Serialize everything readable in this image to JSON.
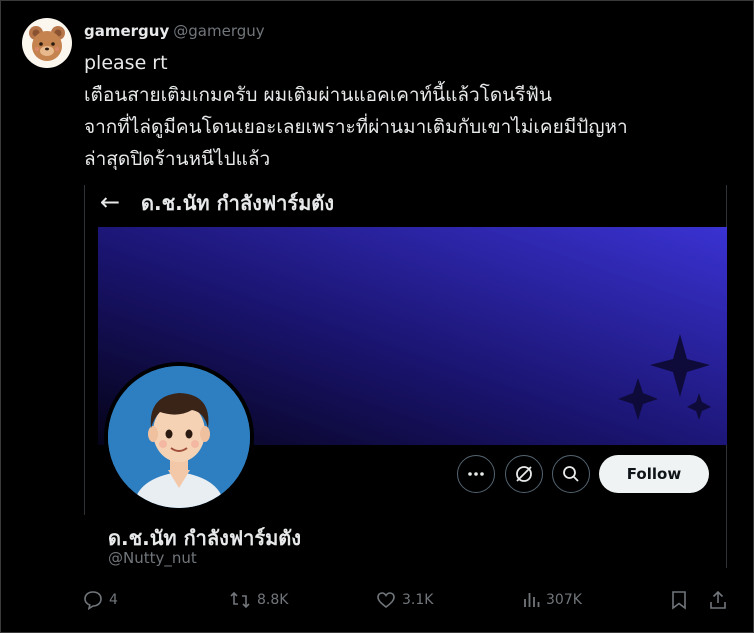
{
  "tweet": {
    "author_name": "gamerguy",
    "author_handle": "@gamerguy",
    "lines": [
      "please rt",
      "เตือนสายเติมเกมครับ ผมเติมผ่านแอคเคาท์นี้แล้วโดนรีฟัน",
      "จากที่ไล่ดูมีคนโดนเยอะเลยเพราะที่ผ่านมาเติมกับเขาไม่เคยมีปัญหา",
      "ล่าสุดปิดร้านหนีไปแล้ว"
    ]
  },
  "embed": {
    "title": "ด.ช.นัท กำลังฟาร์มตัง",
    "follow_label": "Follow",
    "profile_name": "ด.ช.นัท กำลังฟาร์มตัง",
    "profile_handle": "@Nutty_nut",
    "banner_colors": [
      "#050318",
      "#3a32d2"
    ]
  },
  "actions": {
    "replies": "4",
    "reposts": "8.8K",
    "likes": "3.1K",
    "views": "307K"
  }
}
